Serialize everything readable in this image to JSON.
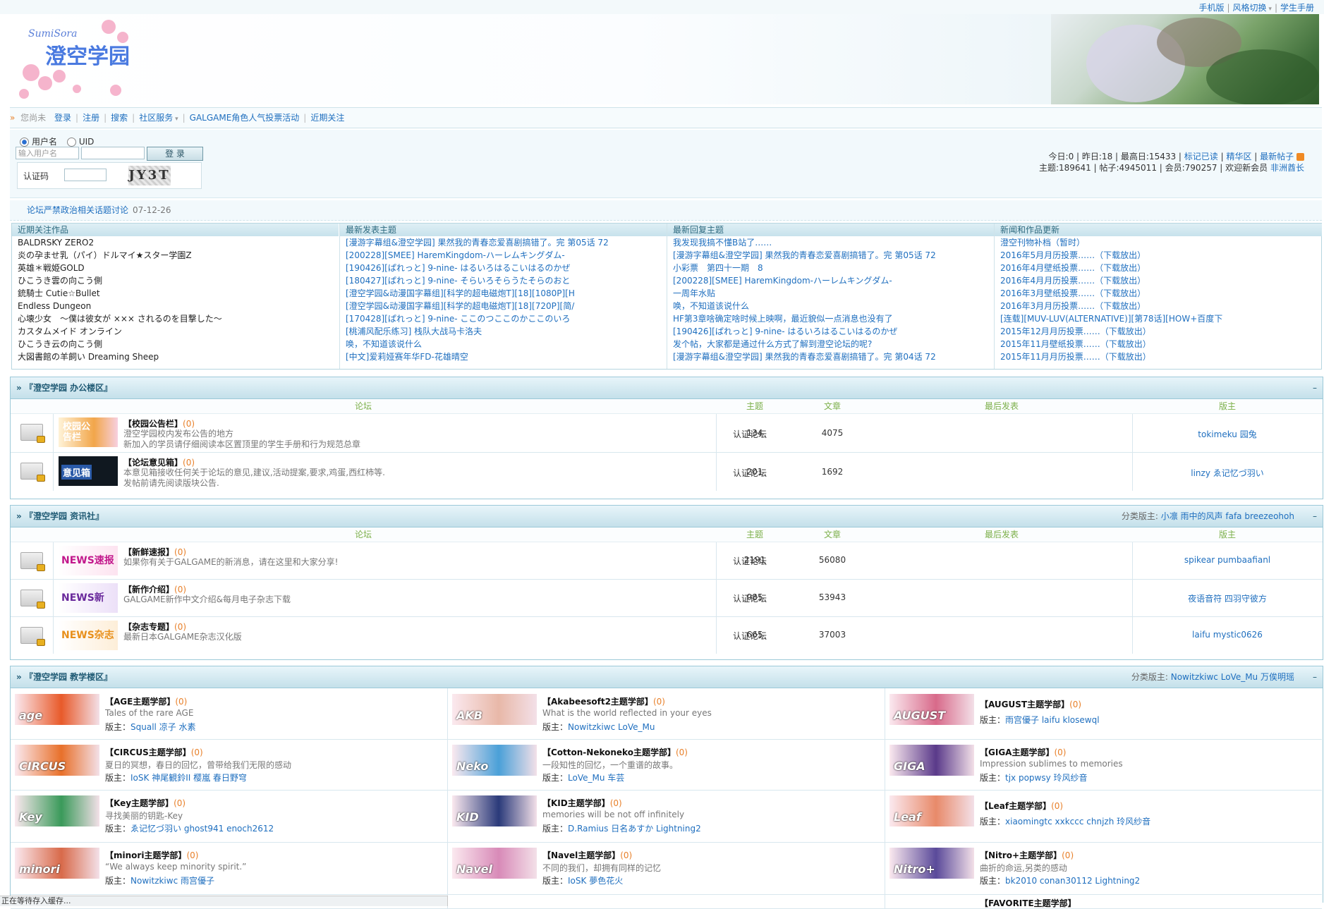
{
  "top_links": [
    "手机版",
    "风格切换",
    "学生手册"
  ],
  "logo_text": "澄空学园",
  "logo_sub": "SumiSora",
  "nav": {
    "greeting": "您尚未",
    "items": [
      "登录",
      "注册",
      "搜索",
      "社区服务",
      "GALGAME角色人气投票活动",
      "近期关注"
    ]
  },
  "login": {
    "radio_username": "用户名",
    "radio_uid": "UID",
    "username_placeholder": "输入用户名",
    "submit": "登 录",
    "captcha_label": "认证码",
    "captcha_text": "JY3T"
  },
  "stats": {
    "line1": [
      "今日:0",
      "昨日:18",
      "最高日:15433"
    ],
    "line1_links": [
      "标记已读",
      "精华区",
      "最新帖子"
    ],
    "line2": "主题:189641 | 帖子:4945011 | 会员:790257 | 欢迎新会员",
    "new_member": "非洲酋长"
  },
  "notice": {
    "text": "论坛严禁政治相关话题讨论",
    "date": "07-12-26"
  },
  "columns": [
    {
      "title": "近期关注作品",
      "items": [
        "BALDRSKY ZERO2",
        "炎の孕ませ乳（パイ）ドルマイ★スター学園Z",
        "英雄＊戦姫GOLD",
        "ひこうき雲の向こう側",
        "銃騎士 Cutie☆Bullet",
        "Endless Dungeon",
        "心壊少女　～僕は彼女が ××× されるのを目撃した～",
        "カスタムメイド オンライン",
        "ひこうき云の向こう側",
        "大図書館の羊飼い Dreaming Sheep"
      ]
    },
    {
      "title": "最新发表主题",
      "items": [
        "[漫游字幕组&澄空学园] 果然我的青春恋爱喜剧搞错了。完 第05话 72",
        "[200228][SMEE] HaremKingdom-ハーレムキングダム-",
        "[190426][ぱれっと] 9-nine- はるいろはるこいはるのかぜ",
        "[180427][ぱれっと] 9-nine- そらいろそらうたそらのおと",
        "[澄空学园&动漫国字幕组][科学的超电磁炮T][18][1080P][H",
        "[澄空学园&动漫国字幕组][科学的超电磁炮T][18][720P][简/",
        "[170428][ぱれっと] 9-nine- ここのつここのかここのいろ",
        "[桃浦风配乐练习] 栈队大战马卡洛夫",
        "唤，不知道该说什么",
        "[中文]爱莉娅赛年华FD-花雄晴空"
      ]
    },
    {
      "title": "最新回复主题",
      "items": [
        "我发现我搞不懂B站了……",
        "[漫游字幕组&澄空学园] 果然我的青春恋爱喜剧搞错了。完 第05话 72",
        "小彩票　第四十一期　8",
        "[200228][SMEE] HaremKingdom-ハーレムキングダム-",
        "一周年水贴",
        "唤，不知道该说什么",
        "HF第3章啥确定啥时候上映啊，最近貌似一点消息也没有了",
        "[190426][ぱれっと] 9-nine- はるいろはるこいはるのかぜ",
        "发个帖，大家都是通过什么方式了解到澄空论坛的呢?",
        "[漫游字幕组&澄空学园] 果然我的青春恋爱喜剧搞错了。完 第04话 72"
      ]
    },
    {
      "title": "新闻和作品更新",
      "items": [
        "澄空刊物补档（暂时）",
        "2016年5月月历投票……（下载放出）",
        "2016年4月壁纸投票……（下载放出）",
        "2016年4月月历投票……（下载放出）",
        "2016年3月壁纸投票……（下载放出）",
        "2016年3月月历投票……（下载放出）",
        "[连载][MUV-LUV(ALTERNATIVE)][第78话][HOW+百度下",
        "2015年12月月历投票……（下载放出）",
        "2015年11月壁纸投票……（下载放出）",
        "2015年11月月历投票……（下载放出）"
      ]
    }
  ],
  "table_headers": {
    "forum": "论坛",
    "topics": "主题",
    "posts": "文章",
    "last": "最后发表",
    "moderator": "版主"
  },
  "sections": [
    {
      "title": "『澄空学园 办公楼区』",
      "moderators_label": "",
      "moderators": [],
      "forums": [
        {
          "name": "【校园公告栏】",
          "count": "(0)",
          "desc": [
            "澄空学园校内发布公告的地方",
            "新加入的学员请仔细阅读本区置顶里的学生手册和行为规范总章"
          ],
          "topics": "134",
          "posts": "4075",
          "last": "认证论坛",
          "mods": "tokimeku 园兔",
          "thumb_text": "校园公告栏",
          "thumb_color": "#f2a64a"
        },
        {
          "name": "【论坛意见箱】",
          "count": "(0)",
          "desc": [
            "本意见箱接收任何关于论坛的意见,建议,活动提案,要求,鸡蛋,西红柿等.",
            "发帖前请先阅读版块公告."
          ],
          "topics": "201",
          "posts": "1692",
          "last": "认证论坛",
          "mods": "linzy ゑ记忆づ羽い",
          "thumb_text": "意见箱",
          "thumb_color": "#101820"
        }
      ]
    },
    {
      "title": "『澄空学园 资讯社』",
      "moderators_label": "分类版主:",
      "moderators": [
        "小凛",
        "雨中的风声",
        "fafa",
        "breezeohoh"
      ],
      "forums": [
        {
          "name": "【新鲜速报】",
          "count": "(0)",
          "desc": [
            "如果你有关于GALGAME的新消息，请在这里和大家分享!"
          ],
          "topics": "2191",
          "posts": "56080",
          "last": "认证论坛",
          "mods": "spikear pumbaafianl",
          "thumb_text": "NEWS速报",
          "thumb_color": "#c2188c"
        },
        {
          "name": "【新作介绍】",
          "count": "(0)",
          "desc": [
            "GALGAME新作中文介绍&每月电子杂志下载"
          ],
          "topics": "985",
          "posts": "53943",
          "last": "认证论坛",
          "mods": "夜语音符 四羽守彼方",
          "thumb_text": "NEWS新",
          "thumb_color": "#6a2a9c"
        },
        {
          "name": "【杂志专题】",
          "count": "(0)",
          "desc": [
            "最新日本GALGAME杂志汉化版"
          ],
          "topics": "665",
          "posts": "37003",
          "last": "认证论坛",
          "mods": "laifu mystic0626",
          "thumb_text": "NEWS杂志",
          "thumb_color": "#e8901c"
        }
      ]
    },
    {
      "title": "『澄空学园 教学楼区』",
      "moderators_label": "分类版主:",
      "moderators": [
        "Nowitzkiwc",
        "LoVe_Mu",
        "万俟明瑶"
      ],
      "grid": [
        {
          "name": "【AGE主题学部】",
          "count": "(0)",
          "desc": "Tales of the rare AGE",
          "mods_label": "版主：",
          "mods": "Squall 凉子 水素",
          "thumb_text": "age",
          "thumb_color": "#e85a2a"
        },
        {
          "name": "【Akabeesoft2主题学部】",
          "count": "(0)",
          "desc": "What is the world reflected in your eyes",
          "mods_label": "版主：",
          "mods": "Nowitzkiwc LoVe_Mu",
          "thumb_text": "AKB",
          "thumb_color": "#e8b8a8"
        },
        {
          "name": "【AUGUST主题学部】",
          "count": "(0)",
          "desc": "",
          "mods_label": "版主：",
          "mods": "雨宫優子 laifu klosewql",
          "thumb_text": "AUGUST",
          "thumb_color": "#d86a8a"
        },
        {
          "name": "【CIRCUS主题学部】",
          "count": "(0)",
          "desc": "夏日的冥想，春日的回忆，曾带给我们无限的感动",
          "mods_label": "版主：",
          "mods": "IoSK 神尾観鈴II 樱嵐 春日野穹",
          "thumb_text": "CIRCUS",
          "thumb_color": "#e8702a"
        },
        {
          "name": "【Cotton-Nekoneko主题学部】",
          "count": "(0)",
          "desc": "一段知性的回忆，一个重谱的故事。",
          "mods_label": "版主：",
          "mods": "LoVe_Mu 车芸",
          "thumb_text": "Neko",
          "thumb_color": "#4aa0d8"
        },
        {
          "name": "【GIGA主题学部】",
          "count": "(0)",
          "desc": "Impression sublimes to memories",
          "mods_label": "版主：",
          "mods": "tjx popwsy 玲风纱音",
          "thumb_text": "GIGA",
          "thumb_color": "#5a3a8a"
        },
        {
          "name": "【Key主题学部】",
          "count": "(0)",
          "desc": "寻找美丽的钥匙-Key",
          "mods_label": "版主：",
          "mods": "ゑ记忆づ羽い ghost941 enoch2612",
          "thumb_text": "Key",
          "thumb_color": "#3a9a5a"
        },
        {
          "name": "【KID主题学部】",
          "count": "(0)",
          "desc": "memories will be not off infinitely",
          "mods_label": "版主：",
          "mods": "D.Ramius 日名あすか Lightning2",
          "thumb_text": "KID",
          "thumb_color": "#2a3a7a"
        },
        {
          "name": "【Leaf主题学部】",
          "count": "(0)",
          "desc": "",
          "mods_label": "版主：",
          "mods": "xiaomingtc xxkccc chnjzh 玲风纱音",
          "thumb_text": "Leaf",
          "thumb_color": "#e88a6a"
        },
        {
          "name": "【minori主题学部】",
          "count": "(0)",
          "desc": "“We always keep minority spirit.”",
          "mods_label": "版主：",
          "mods": "Nowitzkiwc 雨宫優子",
          "thumb_text": "minori",
          "thumb_color": "#d86a4a"
        },
        {
          "name": "【Navel主题学部】",
          "count": "(0)",
          "desc": "不同的我们，却拥有同样的记忆",
          "mods_label": "版主：",
          "mods": "IoSK 夢色花火",
          "thumb_text": "Navel",
          "thumb_color": "#d88ab8"
        },
        {
          "name": "【Nitro+主题学部】",
          "count": "(0)",
          "desc": "曲折的命运,另类的感动",
          "mods_label": "版主：",
          "mods": "bk2010 conan30112 Lightning2",
          "thumb_text": "Nitro+",
          "thumb_color": "#5a4a9a"
        }
      ],
      "partial_next": "【FAVORITE主题学部】"
    }
  ],
  "statusbar": "正在等待存入缓存..."
}
